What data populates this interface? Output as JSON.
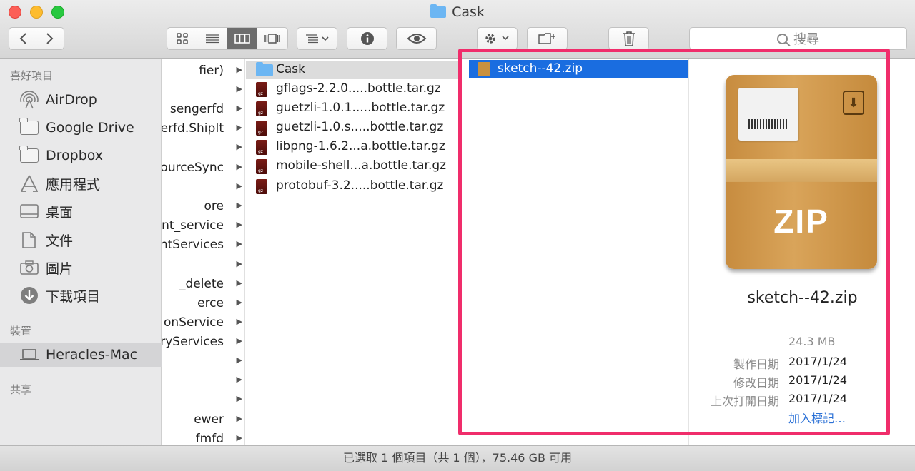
{
  "window": {
    "title": "Cask"
  },
  "toolbar": {
    "search_placeholder": "搜尋",
    "icons": [
      "chevron-left-icon",
      "chevron-right-icon",
      "icon-view-icon",
      "list-view-icon",
      "column-view-icon",
      "coverflow-view-icon",
      "arrange-icon",
      "info-icon",
      "quicklook-eye-icon",
      "gear-icon",
      "new-folder-icon",
      "trash-icon",
      "search-icon"
    ]
  },
  "sidebar": {
    "favorites_header": "喜好項目",
    "favorites": [
      {
        "label": "AirDrop",
        "icon": "airdrop-icon"
      },
      {
        "label": "Google Drive",
        "icon": "folder-icon"
      },
      {
        "label": "Dropbox",
        "icon": "folder-icon"
      },
      {
        "label": "應用程式",
        "icon": "applications-icon"
      },
      {
        "label": "桌面",
        "icon": "desktop-icon"
      },
      {
        "label": "文件",
        "icon": "documents-icon"
      },
      {
        "label": "圖片",
        "icon": "camera-icon"
      },
      {
        "label": "下載項目",
        "icon": "download-icon"
      }
    ],
    "devices_header": "裝置",
    "devices": [
      {
        "label": "Heracles-Mac",
        "icon": "laptop-icon"
      }
    ],
    "shared_header": "共享"
  },
  "column1": {
    "items": [
      "fier)",
      "",
      "sengerfd",
      "erfd.ShipIt",
      "",
      "ourceSync",
      "",
      "ore",
      "nt_service",
      "ntServices",
      "",
      "_delete",
      "erce",
      "onService",
      "ryServices",
      "",
      "",
      "",
      "ewer",
      "fmfd"
    ]
  },
  "column2": {
    "items": [
      {
        "name": "Cask",
        "type": "folder"
      },
      {
        "name": "gflags-2.2.0.....bottle.tar.gz",
        "type": "gz"
      },
      {
        "name": "guetzli-1.0.1.....bottle.tar.gz",
        "type": "gz"
      },
      {
        "name": "guetzli-1.0.s.....bottle.tar.gz",
        "type": "gz"
      },
      {
        "name": "libpng-1.6.2...a.bottle.tar.gz",
        "type": "gz"
      },
      {
        "name": "mobile-shell...a.bottle.tar.gz",
        "type": "gz"
      },
      {
        "name": "protobuf-3.2.....bottle.tar.gz",
        "type": "gz"
      }
    ]
  },
  "column3": {
    "items": [
      {
        "name": "sketch--42.zip"
      }
    ]
  },
  "preview": {
    "name": "sketch--42.zip",
    "icon_text": "ZIP",
    "size": "24.3 MB",
    "created_label": "製作日期",
    "created": "2017/1/24",
    "modified_label": "修改日期",
    "modified": "2017/1/24",
    "opened_label": "上次打開日期",
    "opened": "2017/1/24",
    "add_tags": "加入標記…"
  },
  "status": {
    "text": "已選取 1 個項目（共 1 個），75.46 GB 可用"
  },
  "colors": {
    "selection": "#1a6de0",
    "highlight": "#f02d6b",
    "link": "#2a70d6"
  }
}
